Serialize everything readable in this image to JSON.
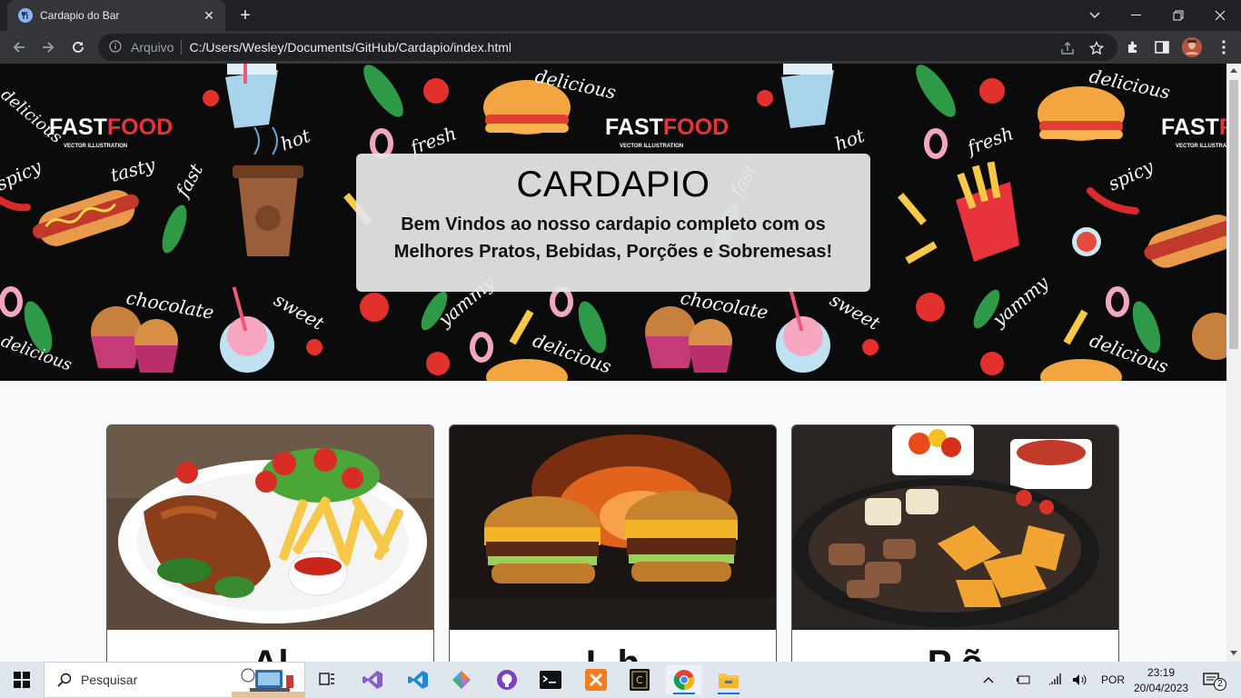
{
  "browser": {
    "tab_title": "Cardapio do Bar",
    "url_scheme": "Arquivo",
    "url": "C:/Users/Wesley/Documents/GitHub/Cardapio/index.html"
  },
  "hero": {
    "title": "CARDAPIO",
    "subtitle": "Bem Vindos ao nosso cardapio completo com os Melhores Pratos, Bebidas, Porções e Sobremesas!",
    "pattern_words": [
      "FASTFOOD",
      "VECTOR ILLUSTRATION",
      "delicious",
      "fresh",
      "hot",
      "tasty",
      "spicy",
      "fast",
      "chocolate",
      "sweet",
      "yammy"
    ]
  },
  "cards": [
    {
      "title": "Al"
    },
    {
      "title": "L    h"
    },
    {
      "title": "P    õ"
    }
  ],
  "taskbar": {
    "search_placeholder": "Pesquisar",
    "language": "POR",
    "time": "23:19",
    "date": "20/04/2023",
    "notifications": "2"
  },
  "colors": {
    "chrome_dark": "#202124",
    "chrome_toolbar": "#35363a",
    "hero_box": "#e5e5e5",
    "page_bg": "#f8f9fa",
    "taskbar_bg": "#dfe6ee"
  }
}
